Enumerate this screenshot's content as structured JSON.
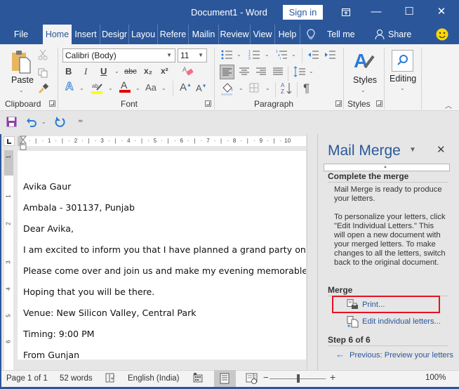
{
  "window": {
    "title": "Document1  -  Word",
    "sign_in": "Sign in",
    "ribbon_display_icon": "ribbon-display-options-icon",
    "minimize": "—",
    "maximize": "☐",
    "close": "✕"
  },
  "tabs": [
    {
      "label": "File"
    },
    {
      "label": "Home",
      "active": true
    },
    {
      "label": "Insert"
    },
    {
      "label": "Desigr"
    },
    {
      "label": "Layou"
    },
    {
      "label": "Refere"
    },
    {
      "label": "Mailin"
    },
    {
      "label": "Review"
    },
    {
      "label": "View"
    },
    {
      "label": "Help"
    }
  ],
  "tell_me": "Tell me",
  "share": "Share",
  "ribbon": {
    "clipboard": {
      "paste_label": "Paste",
      "group_label": "Clipboard"
    },
    "font": {
      "font_name": "Calibri (Body)",
      "font_size": "11",
      "bold": "B",
      "italic": "I",
      "underline": "U",
      "strikethrough": "abc",
      "subscript": "x₂",
      "superscript": "x²",
      "change_case": "Aa",
      "grow_font": "A",
      "shrink_font": "A",
      "text_effects": "A",
      "font_color": "A",
      "highlight_color": "#ffff00",
      "font_color_value": "#e00000",
      "group_label": "Font"
    },
    "paragraph": {
      "group_label": "Paragraph",
      "show_marks": "¶"
    },
    "styles": {
      "label": "Styles",
      "group_label": "Styles"
    },
    "editing": {
      "label": "Editing"
    }
  },
  "ruler": {
    "h_ticks": [
      "1",
      "2",
      "3",
      "4",
      "5",
      "6",
      "7",
      "8",
      "9",
      "10"
    ],
    "v_ticks": [
      "1",
      "1",
      "2",
      "3",
      "4",
      "5",
      "6"
    ]
  },
  "document": {
    "lines": [
      "Avika Gaur",
      "Ambala - 301137, Punjab",
      "Dear Avika,",
      "I am excited to inform you that I have planned a grand party on my",
      "Please come over and join us and make my evening memorable.",
      "Hoping that you will be there.",
      "Venue: New Silicon Valley, Central Park",
      "Timing: 9:00 PM",
      "From Gunjan"
    ]
  },
  "pane": {
    "title": "Mail Merge",
    "section1_head": "Complete the merge",
    "para1": "Mail Merge is ready to produce your letters.",
    "para2": "To personalize your letters, click \"Edit Individual Letters.\" This will open a new document with your merged letters. To make changes to all the letters, switch back to the original document.",
    "section2_head": "Merge",
    "print_link": "Print...",
    "edit_link": "Edit individual letters...",
    "step_head": "Step 6 of 6",
    "previous_link": "Previous: Preview your letters"
  },
  "status": {
    "page": "Page 1 of 1",
    "words": "52 words",
    "language": "English (India)",
    "zoom_minus": "−",
    "zoom_plus": "+",
    "zoom_level": "100%",
    "zoom_percent": 100
  },
  "colors": {
    "brand": "#2b579a",
    "highlight_box": "#e81123"
  }
}
